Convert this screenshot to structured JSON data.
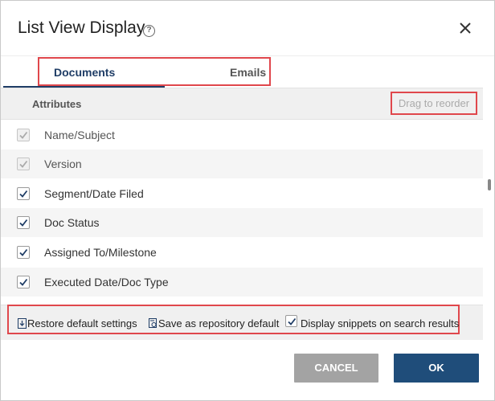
{
  "dialog": {
    "title": "List View Display",
    "help_icon": "?"
  },
  "tabs": [
    {
      "label": "Documents",
      "active": true
    },
    {
      "label": "Emails",
      "active": false
    }
  ],
  "attributes": {
    "title": "Attributes",
    "drag_hint": "Drag to reorder",
    "items": [
      {
        "label": "Name/Subject",
        "checked": true,
        "disabled": true
      },
      {
        "label": "Version",
        "checked": true,
        "disabled": true
      },
      {
        "label": "Segment/Date Filed",
        "checked": true,
        "disabled": false
      },
      {
        "label": "Doc Status",
        "checked": true,
        "disabled": false
      },
      {
        "label": "Assigned To/Milestone",
        "checked": true,
        "disabled": false
      },
      {
        "label": "Executed Date/Doc Type",
        "checked": true,
        "disabled": false
      }
    ]
  },
  "options": {
    "restore_label": "Restore default settings",
    "save_label": "Save as repository default",
    "snippets_label": "Display snippets on search results",
    "snippets_checked": true
  },
  "buttons": {
    "cancel": "CANCEL",
    "ok": "OK"
  },
  "colors": {
    "accent": "#1f3d66",
    "primary_button": "#1f4d7a",
    "secondary_button": "#a3a3a3",
    "highlight": "#e0474c"
  }
}
